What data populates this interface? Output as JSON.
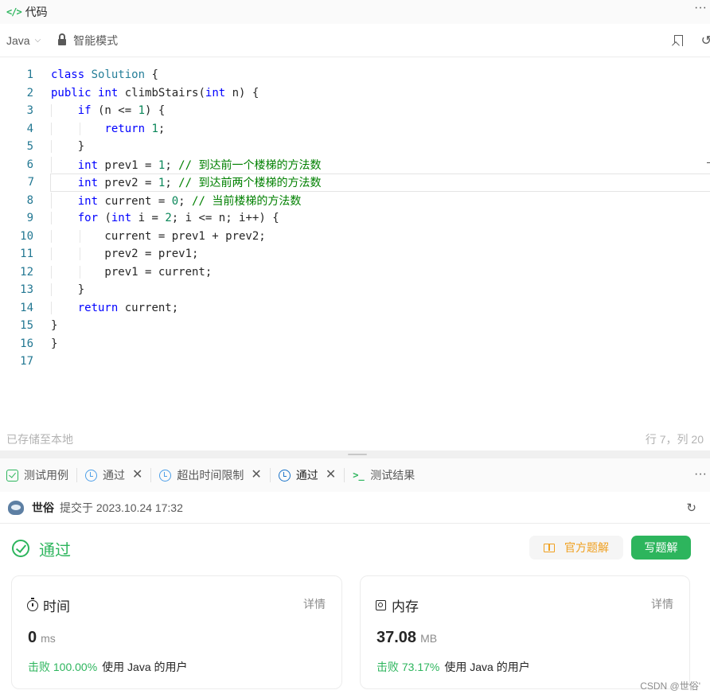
{
  "code_panel": {
    "title": "代码",
    "code_icon": "</>",
    "menu_icon": "···",
    "language": "Java",
    "mode": "智能模式",
    "lines": [
      {
        "n": "1"
      },
      {
        "n": "2"
      },
      {
        "n": "3"
      },
      {
        "n": "4"
      },
      {
        "n": "5"
      },
      {
        "n": "6"
      },
      {
        "n": "7"
      },
      {
        "n": "8"
      },
      {
        "n": "9"
      },
      {
        "n": "10"
      },
      {
        "n": "11"
      },
      {
        "n": "12"
      },
      {
        "n": "13"
      },
      {
        "n": "14"
      },
      {
        "n": "15"
      },
      {
        "n": "16"
      },
      {
        "n": "17"
      }
    ],
    "comment_6": "// 到达前一个楼梯的方法数",
    "comment_7": "// 到达前两个楼梯的方法数",
    "comment_8": "// 当前楼梯的方法数",
    "status_left": "已存储至本地",
    "status_right": "行 7，列 20"
  },
  "result_panel": {
    "tabs": [
      {
        "label": "测试用例"
      },
      {
        "label": "通过"
      },
      {
        "label": "超出时间限制"
      },
      {
        "label": "通过"
      },
      {
        "label": "测试结果"
      }
    ],
    "menu_icon": "···",
    "user": "世俗",
    "submitted": "提交于 2023.10.24 17:32",
    "verdict": "通过",
    "official_solution": "官方题解",
    "write_solution": "写题解",
    "time_card": {
      "title": "时间",
      "detail": "详情",
      "value": "0",
      "unit": "ms",
      "beat_pct": "击败 100.00%",
      "beat_text": "使用 Java 的用户"
    },
    "memory_card": {
      "title": "内存",
      "detail": "详情",
      "value": "37.08",
      "unit": "MB",
      "beat_pct": "击败 73.17%",
      "beat_text": "使用 Java 的用户"
    },
    "watermark": "CSDN @世俗'"
  },
  "colors": {
    "accent_green": "#2db55d",
    "official_orange": "#f0a020",
    "keyword_blue": "#0000ff",
    "comment_green": "#008000",
    "line_number": "#237893"
  }
}
